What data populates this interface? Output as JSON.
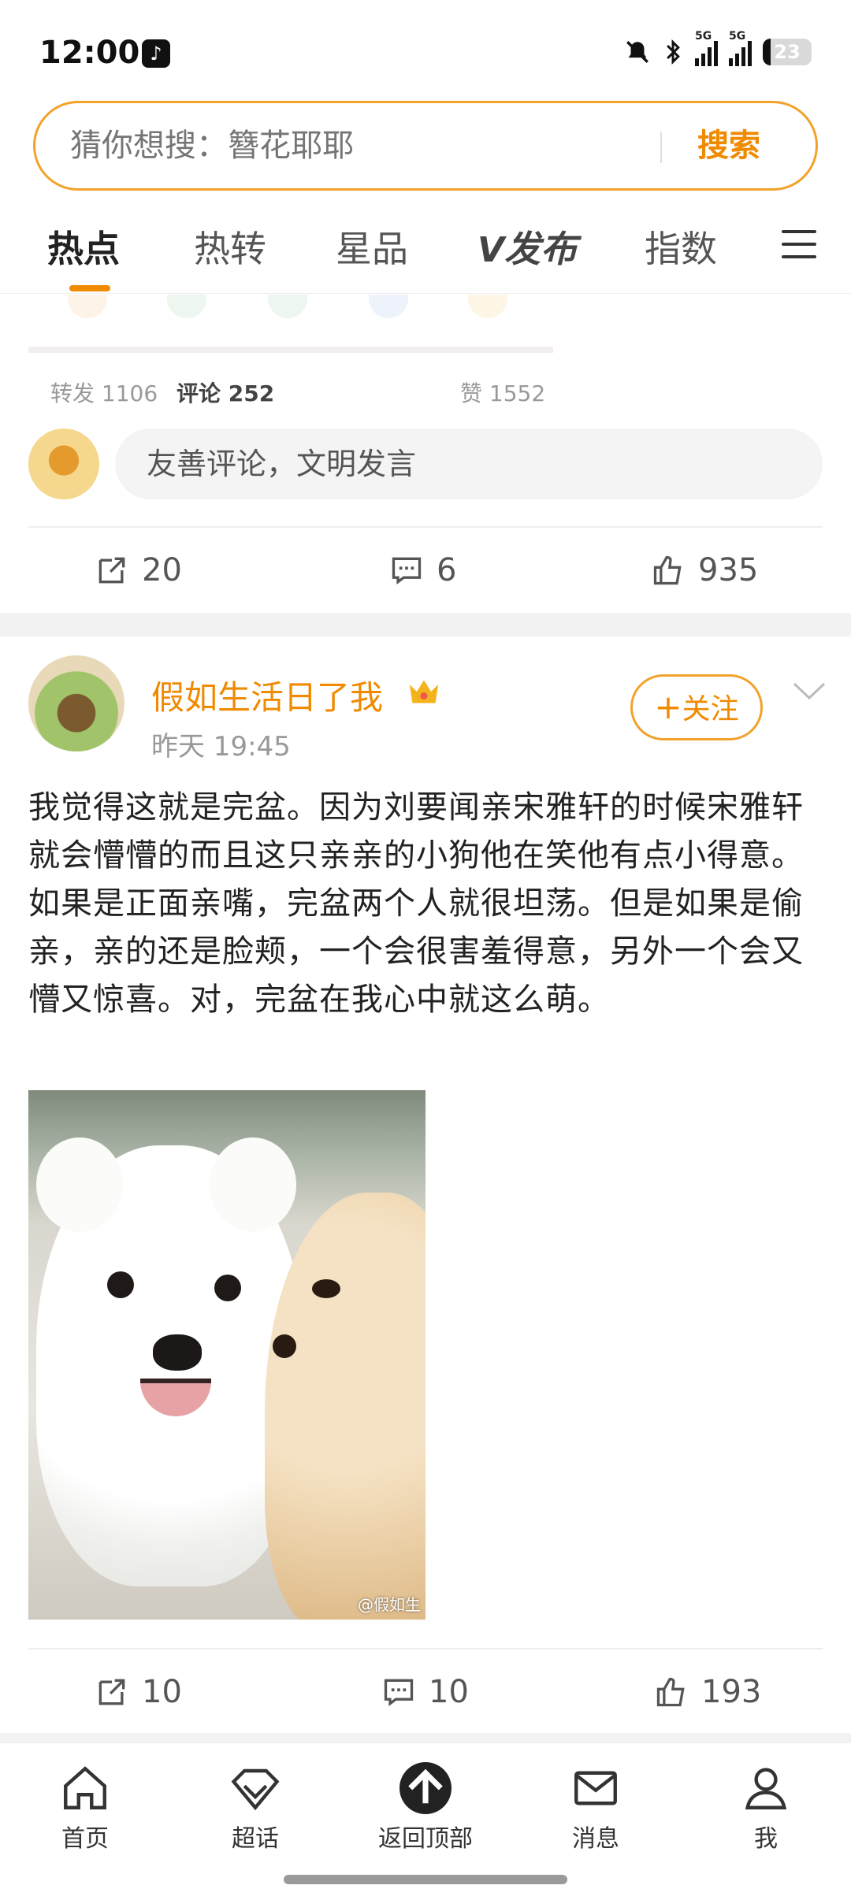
{
  "status_bar": {
    "time": "12:00",
    "battery": "23",
    "signal_label_1": "5G",
    "signal_label_2": "5G"
  },
  "search": {
    "placeholder": "猜你想搜：簪花耶耶",
    "button": "搜索"
  },
  "tabs": [
    {
      "label": "热点",
      "active": true
    },
    {
      "label": "热转",
      "active": false
    },
    {
      "label": "星品",
      "active": false
    },
    {
      "label": "发布",
      "active": false
    },
    {
      "label": "指数",
      "active": false
    }
  ],
  "embedded_post": {
    "reposts": "转发 1106",
    "comments": "评论 252",
    "likes": "赞 1552"
  },
  "comment_box": {
    "placeholder": "友善评论，文明发言"
  },
  "feed_item_1_actions": {
    "repost_count": "20",
    "comment_count": "6",
    "like_count": "935"
  },
  "post": {
    "author": "假如生活日了我",
    "time": "昨天 19:45",
    "follow_label": "关注",
    "text": "我觉得这就是完盆。因为刘要闻亲宋雅轩的时候宋雅轩就会懵懵的而且这只亲亲的小狗他在笑他有点小得意。如果是正面亲嘴，完盆两个人就很坦荡。但是如果是偷亲，亲的还是脸颊，一个会很害羞得意，另外一个会又懵又惊喜。对，完盆在我心中就这么萌。",
    "image_watermark": "@假如生",
    "repost_count": "10",
    "comment_count": "10",
    "like_count": "193"
  },
  "bottom_nav": [
    {
      "label": "首页",
      "icon": "home-icon"
    },
    {
      "label": "超话",
      "icon": "diamond-icon"
    },
    {
      "label": "返回顶部",
      "icon": "arrow-up-icon"
    },
    {
      "label": "消息",
      "icon": "mail-icon"
    },
    {
      "label": "我",
      "icon": "person-icon"
    }
  ],
  "colors": {
    "accent": "#f08a00",
    "search_border": "#f2a22b",
    "text": "#222222",
    "muted": "#999999"
  }
}
